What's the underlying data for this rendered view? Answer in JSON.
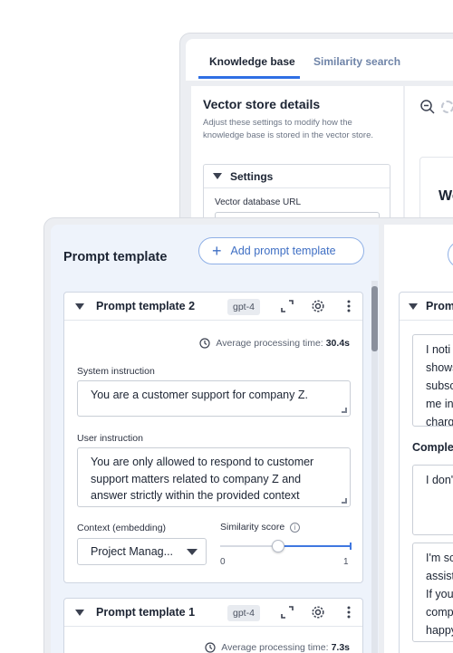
{
  "knowledge_base": {
    "tabs": [
      "Knowledge base",
      "Similarity search"
    ],
    "title": "Vector store details",
    "description": "Adjust these settings to modify how the knowledge base is stored in the vector store.",
    "settings_label": "Settings",
    "db_url_label": "Vector database URL",
    "preview_text": "We"
  },
  "prompt_panel": {
    "title": "Prompt template",
    "add_button_label": "Add prompt template",
    "templates": [
      {
        "name": "Prompt template 2",
        "model": "gpt-4",
        "avg_time_label": "Average processing time:",
        "avg_time_value": "30.4s",
        "system_label": "System instruction",
        "system_value": "You are a customer support for company Z.",
        "user_label": "User instruction",
        "user_value": "You are only allowed to respond to customer support matters related to company Z and answer strictly within the provided context",
        "context_label": "Context (embedding)",
        "context_value": "Project Manag...",
        "similarity_label": "Similarity score",
        "similarity_value": 0.45,
        "similarity_min": "0",
        "similarity_max": "1"
      },
      {
        "name": "Prompt template 1",
        "model": "gpt-4",
        "avg_time_label": "Average processing time:",
        "avg_time_value": "7.3s"
      }
    ]
  },
  "right_pane": {
    "card_title": "Prom",
    "message_lines": [
      "I noti",
      "shows",
      "subsc",
      "me in",
      "charg"
    ],
    "completion_label": "Complet",
    "completion_lines": [
      "I don'"
    ],
    "response_lines": [
      "I'm sc",
      "assist",
      "If you",
      "comp",
      "happy"
    ]
  }
}
